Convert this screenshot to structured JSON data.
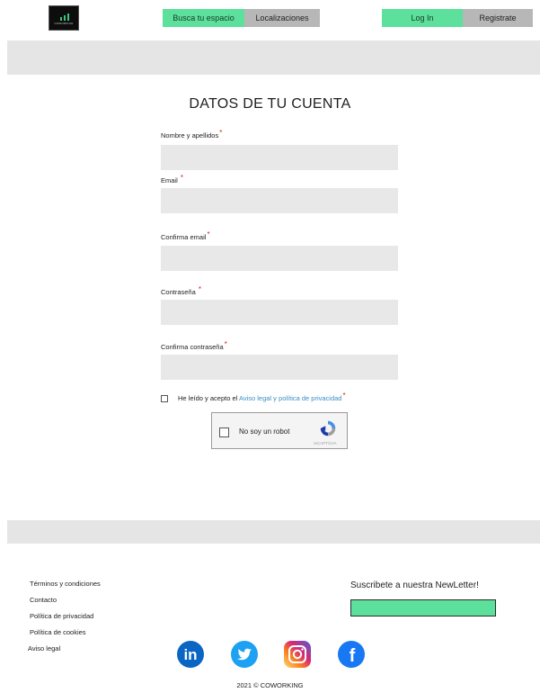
{
  "header": {
    "logo_text": "COWORKING",
    "nav": [
      {
        "label": "Busca tu espacio"
      },
      {
        "label": "Localizaciones"
      }
    ],
    "auth": [
      {
        "label": "Log In"
      },
      {
        "label": "Registrate"
      }
    ]
  },
  "form": {
    "title": "DATOS DE TU CUENTA",
    "required_mark": "*",
    "fields": [
      {
        "label": "Nombre y apellidos",
        "value": ""
      },
      {
        "label": "Email",
        "value": ""
      },
      {
        "label": "Confirma email",
        "value": ""
      },
      {
        "label": "Contraseña",
        "value": ""
      },
      {
        "label": "Confirma contraseña",
        "value": ""
      }
    ],
    "terms_prefix": "He leído y acepto el ",
    "terms_link": "Aviso legal y política de privacidad",
    "captcha": {
      "label": "No soy un robot",
      "brand": "reCAPTCHA"
    }
  },
  "footer": {
    "links": [
      "Términos y condiciones",
      "Contacto",
      "Política de privacidad",
      "Política de cookies",
      "Aviso legal"
    ],
    "newsletter_title": "Suscribete a nuestra NewLetter!",
    "newsletter_value": "",
    "social": [
      {
        "icon": "linkedin-icon",
        "color": "#0a66c2"
      },
      {
        "icon": "twitter-icon",
        "color": "#1da1f2"
      },
      {
        "icon": "instagram-icon",
        "color": "#d62976"
      },
      {
        "icon": "facebook-icon",
        "color": "#1877f2"
      }
    ],
    "social_glyphs": {
      "linkedin": "in",
      "facebook": "f"
    },
    "copyright": "2021 © COWORKING"
  },
  "colors": {
    "accent": "#5ce09b",
    "grey_button": "#b7b7b7",
    "band": "#e5e5e5",
    "required": "#e02020",
    "link": "#3a8fc4"
  }
}
